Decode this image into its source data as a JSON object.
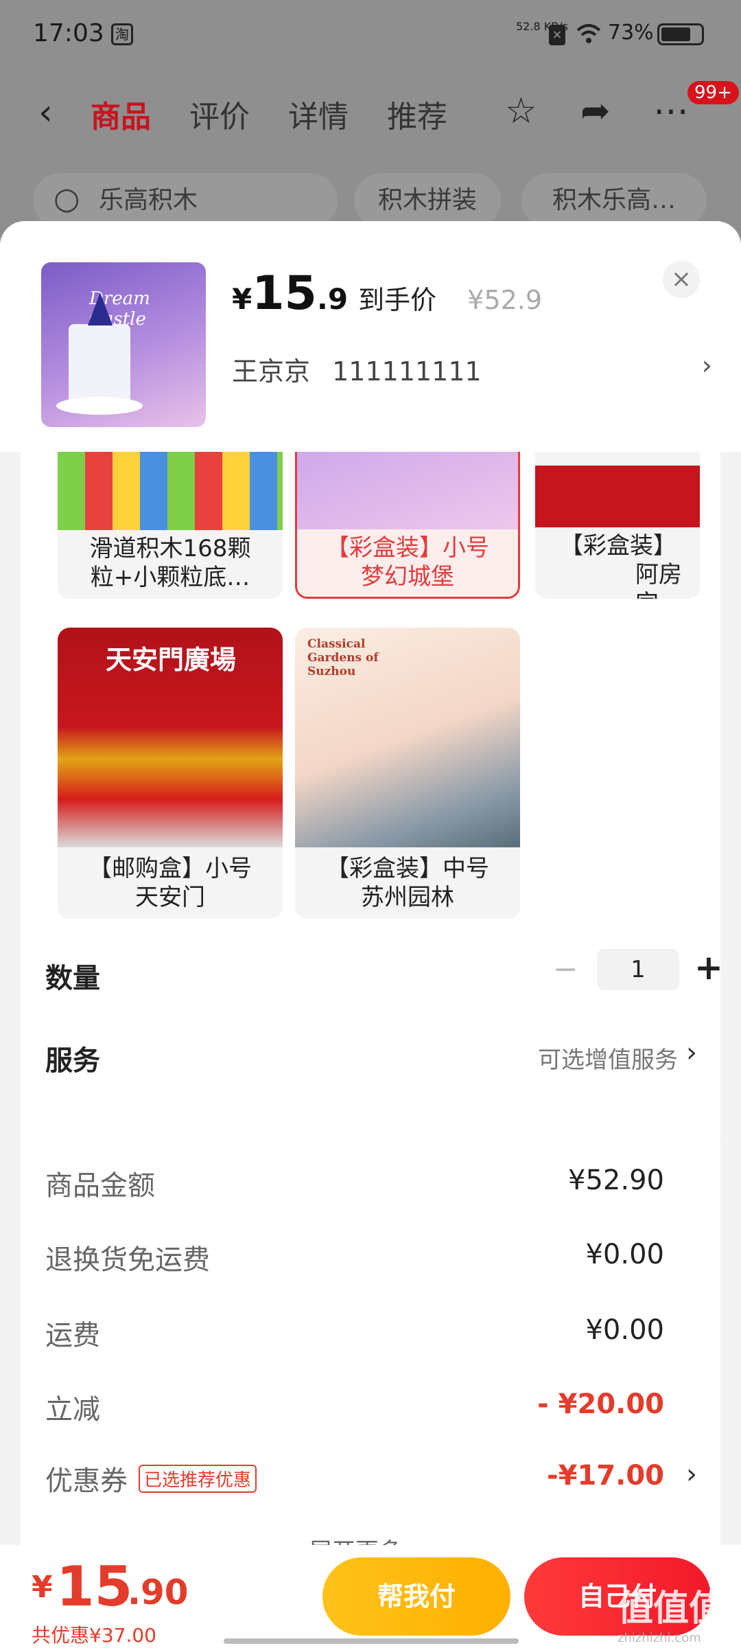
{
  "status_bar": {
    "time": "17:03",
    "app_icon_text": "淘",
    "net_speed": "52.8 KB/s",
    "battery": "73%"
  },
  "nav": {
    "tabs": [
      "商品",
      "评价",
      "详情",
      "推荐"
    ],
    "badge": "99+",
    "icons": [
      "back-arrow-icon",
      "star-icon",
      "share-icon",
      "more-icon"
    ]
  },
  "search": {
    "query": "乐高积木",
    "chips": [
      "积木拼装",
      "积木乐高…"
    ]
  },
  "header": {
    "price_yen": "¥",
    "price_int": "15",
    "price_dec": ".9",
    "price_tag": "到手价",
    "original_price": "¥52.9",
    "address_name": "王京京",
    "address_phone": "111111111"
  },
  "variants": [
    {
      "label_line1": "滑道积木168颗",
      "label_line2": "粒+小颗粒底…",
      "selected": false
    },
    {
      "label_line1": "【彩盒装】小号",
      "label_line2": "梦幻城堡",
      "selected": true
    },
    {
      "label_line1": "【彩盒装】",
      "label_line2": "阿房宫",
      "selected": false
    },
    {
      "label_line1": "【邮购盒】小号",
      "label_line2": "天安门",
      "image_text": "天安門廣場",
      "selected": false
    },
    {
      "label_line1": "【彩盒装】中号",
      "label_line2": "苏州园林",
      "image_text": "Classical Gardens of Suzhou",
      "selected": false
    }
  ],
  "quantity": {
    "label": "数量",
    "value": "1"
  },
  "service": {
    "label": "服务",
    "hint": "可选增值服务"
  },
  "summary": {
    "rows": [
      {
        "label": "商品金额",
        "value": "¥52.90"
      },
      {
        "label": "退换货免运费",
        "value": "¥0.00"
      },
      {
        "label": "运费",
        "value": "¥0.00"
      },
      {
        "label": "立减",
        "value": "- ¥20.00"
      },
      {
        "label": "优惠券",
        "tag": "已选推荐优惠",
        "value": "-¥17.00"
      }
    ],
    "expand": "展开更多"
  },
  "footer": {
    "yen": "¥",
    "total_int": "15",
    "total_dec": ".90",
    "savings": "共优惠¥37.00",
    "help_pay": "帮我付",
    "self_pay": "自己付"
  },
  "watermark": {
    "text": "值值值",
    "sub": "zhizhizhi.com"
  },
  "colors": {
    "accent_red": "#e33c2b",
    "tab_active": "#c8141e",
    "help_btn": "#ffb000",
    "self_btn": "#f2192a"
  }
}
